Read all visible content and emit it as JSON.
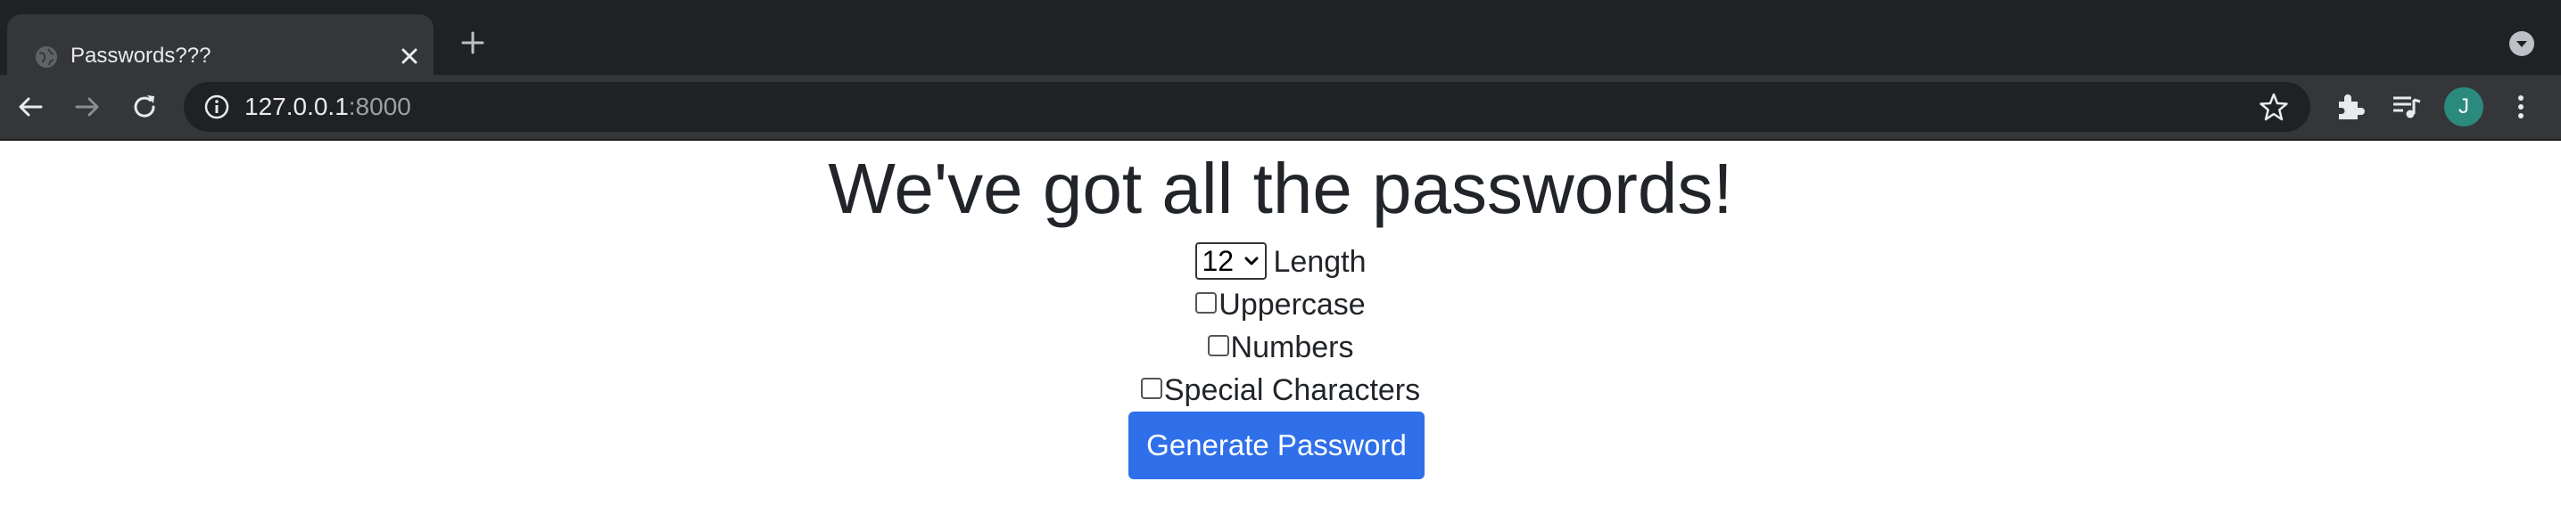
{
  "browser": {
    "tab": {
      "title": "Passwords???",
      "favicon": "globe-icon",
      "close_icon": "close-icon"
    },
    "new_tab_icon": "plus-icon",
    "tab_search_icon": "chevron-down-icon",
    "nav": {
      "back_icon": "arrow-left-icon",
      "forward_icon": "arrow-right-icon",
      "reload_icon": "reload-icon"
    },
    "omnibox": {
      "info_icon": "info-icon",
      "host": "127.0.0.1",
      "port": ":8000",
      "bookmark_icon": "star-icon"
    },
    "toolbar_icons": [
      "puzzle-icon",
      "media-queue-icon",
      "kebab-menu-icon"
    ],
    "profile_initial": "J",
    "colors": {
      "tabstrip": "#202124",
      "toolbar": "#35363a",
      "avatar": "#2b8a7e"
    }
  },
  "page": {
    "heading": "We've got all the passwords!",
    "length": {
      "selected": "12",
      "label": "Length"
    },
    "options": [
      {
        "label": "Uppercase",
        "checked": false
      },
      {
        "label": "Numbers",
        "checked": false
      },
      {
        "label": "Special Characters",
        "checked": false
      }
    ],
    "generate_button": "Generate Password",
    "colors": {
      "button": "#2f6fe9",
      "text": "#212529"
    }
  }
}
